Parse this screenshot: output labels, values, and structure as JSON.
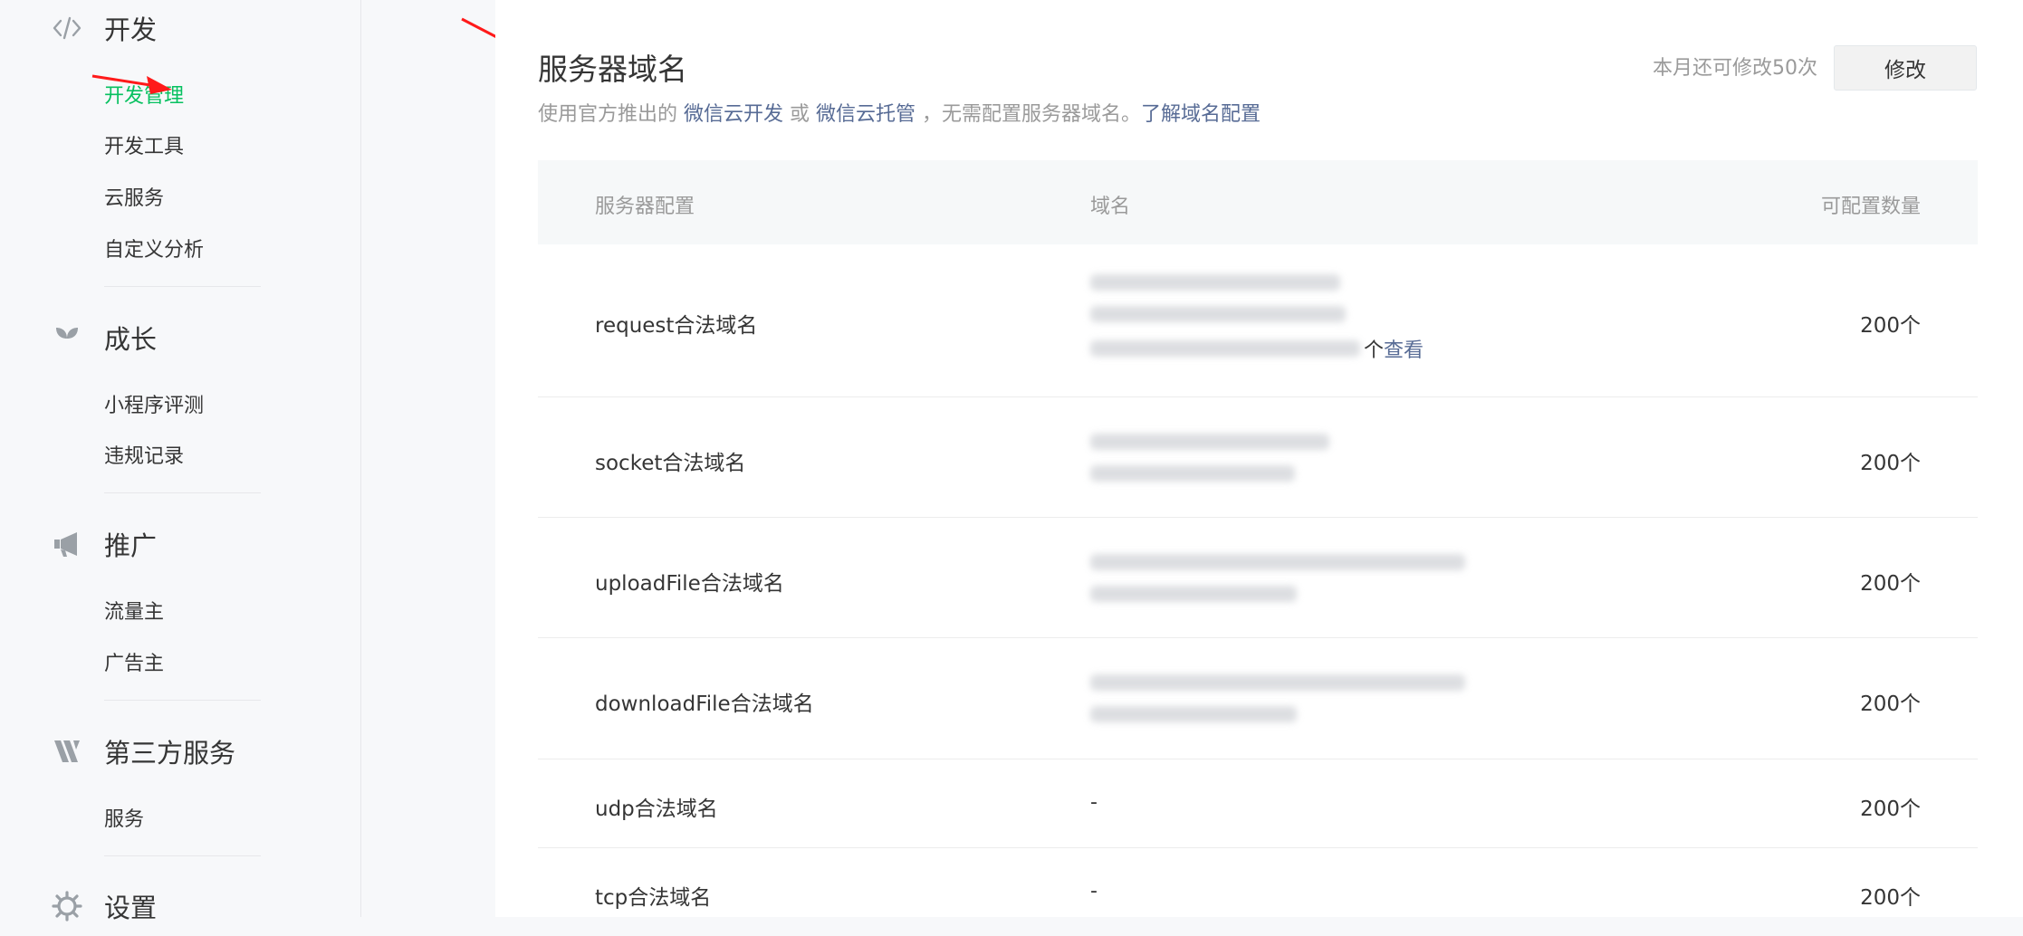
{
  "sidebar": {
    "sections": [
      {
        "title": "开发",
        "icon": "code-icon",
        "items": [
          "开发管理",
          "开发工具",
          "云服务",
          "自定义分析"
        ],
        "active": "开发管理"
      },
      {
        "title": "成长",
        "icon": "sprout-icon",
        "items": [
          "小程序评测",
          "违规记录"
        ]
      },
      {
        "title": "推广",
        "icon": "megaphone-icon",
        "items": [
          "流量主",
          "广告主"
        ]
      },
      {
        "title": "第三方服务",
        "icon": "third-party-icon",
        "items": [
          "服务"
        ]
      },
      {
        "title": "设置",
        "icon": "gear-icon",
        "items": []
      }
    ]
  },
  "main": {
    "title": "服务器域名",
    "subtitle": {
      "prefix": "使用官方推出的 ",
      "link1": "微信云开发",
      "mid": " 或 ",
      "link2": "微信云托管",
      "suffix": " ，无需配置服务器域名。",
      "link3": "了解域名配置"
    },
    "quota_text": "本月还可修改50次",
    "edit_button": "修改",
    "table": {
      "headers": [
        "服务器配置",
        "域名",
        "可配置数量"
      ],
      "rows": [
        {
          "name": "request合法域名",
          "domain": "",
          "count": "200个",
          "extra": "个",
          "view": "查看"
        },
        {
          "name": "socket合法域名",
          "domain": "",
          "count": "200个"
        },
        {
          "name": "uploadFile合法域名",
          "domain": "",
          "count": "200个"
        },
        {
          "name": "downloadFile合法域名",
          "domain": "",
          "count": "200个"
        },
        {
          "name": "udp合法域名",
          "domain": "-",
          "count": "200个"
        },
        {
          "name": "tcp合法域名",
          "domain": "-",
          "count": "200个"
        }
      ]
    }
  },
  "colors": {
    "accent": "#07c160",
    "link": "#576b95",
    "annotation_arrow": "#ff1a1a"
  }
}
